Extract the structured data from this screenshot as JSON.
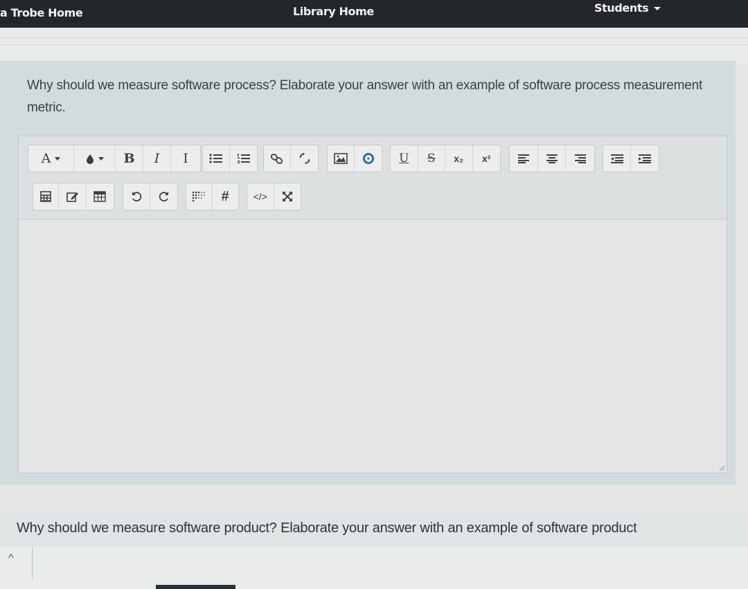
{
  "nav": {
    "home": "a Trobe Home",
    "library": "Library Home",
    "students": "Students"
  },
  "question1": {
    "text": "Why should we measure software process? Elaborate your answer with an example of software process measurement metric."
  },
  "editor": {
    "font_button": "A",
    "bold": "B",
    "italic": "I",
    "clear_format": "I",
    "underline": "U",
    "strike": "S",
    "subscript": "x₂",
    "superscript": "x²",
    "code": "</>",
    "hash": "#",
    "answer_value": ""
  },
  "question2": {
    "text": "Why should we measure software product? Elaborate your answer with an example of software product"
  },
  "footer": {
    "chevron": "^"
  }
}
